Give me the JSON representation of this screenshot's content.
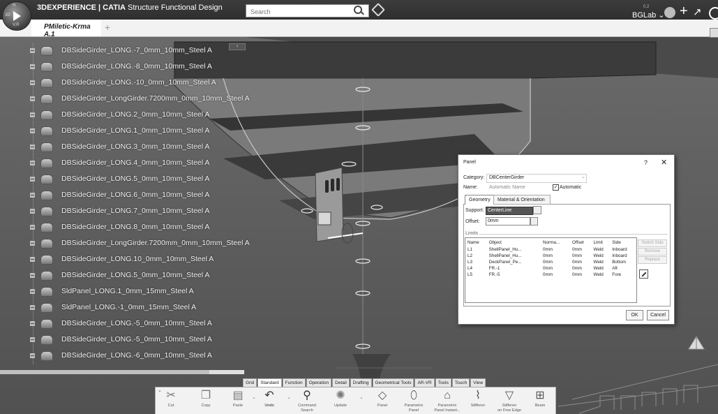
{
  "app": {
    "compass_top": "N",
    "compass_left": "3D",
    "compass_bottom": "V,R",
    "brand_prefix": "3D",
    "brand_suffix": "EXPERIENCE | ",
    "product": "CATIA",
    "workbench": " Structure Functional Design"
  },
  "search": {
    "placeholder": "Search"
  },
  "user": {
    "name": "BGLab ⌄",
    "version": "0.2"
  },
  "tabs": {
    "active": "PMiletic-Krma A.1",
    "add": "+"
  },
  "tree": {
    "items": [
      {
        "label": "DBSideGirder_LONG.-7_0mm_10mm_Steel A"
      },
      {
        "label": "DBSideGirder_LONG.-8_0mm_10mm_Steel A"
      },
      {
        "label": "DBSideGirder_LONG.-10_0mm_10mm_Steel A"
      },
      {
        "label": "DBSideGirder_LongGirder.7200mm_0mm_10mm_Steel A"
      },
      {
        "label": "DBSideGirder_LONG.2_0mm_10mm_Steel A"
      },
      {
        "label": "DBSideGirder_LONG.1_0mm_10mm_Steel A"
      },
      {
        "label": "DBSideGirder_LONG.3_0mm_10mm_Steel A"
      },
      {
        "label": "DBSideGirder_LONG.4_0mm_10mm_Steel A"
      },
      {
        "label": "DBSideGirder_LONG.5_0mm_10mm_Steel A"
      },
      {
        "label": "DBSideGirder_LONG.6_0mm_10mm_Steel A"
      },
      {
        "label": "DBSideGirder_LONG.7_0mm_10mm_Steel A"
      },
      {
        "label": "DBSideGirder_LONG.8_0mm_10mm_Steel A"
      },
      {
        "label": "DBSideGirder_LongGirder.7200mm_0mm_10mm_Steel A"
      },
      {
        "label": "DBSideGirder_LONG.10_0mm_10mm_Steel A"
      },
      {
        "label": "DBSideGirder_LONG.5_0mm_10mm_Steel A"
      },
      {
        "label": "SldPanel_LONG.1_0mm_15mm_Steel A"
      },
      {
        "label": "SldPanel_LONG.-1_0mm_15mm_Steel A"
      },
      {
        "label": "DBSideGirder_LONG.-5_0mm_10mm_Steel A"
      },
      {
        "label": "DBSideGirder_LONG.-5_0mm_10mm_Steel A"
      },
      {
        "label": "DBSideGirder_LONG.-6_0mm_10mm_Steel A"
      }
    ]
  },
  "dialog": {
    "title": "Panel",
    "help": "?",
    "close": "✕",
    "category_label": "Category:",
    "category_value": "DBCenterGirder",
    "name_label": "Name:",
    "name_value": "Automatic Name",
    "automatic_label": "Automatic",
    "automatic_checked": "✓",
    "tabs": {
      "geometry": "Geometry",
      "material": "Material & Orientation"
    },
    "support_label": "Support:",
    "support_value": "CenterLine",
    "offset_label": "Offset:",
    "offset_value": "0mm",
    "limits_label": "Limits",
    "table": {
      "headers": [
        "Name",
        "Object",
        "Norma...",
        "Offset",
        "Limit",
        "Side"
      ],
      "rows": [
        [
          "L1",
          "ShellPanel_Hu...",
          "0mm",
          "0mm",
          "Weld",
          "Inboard"
        ],
        [
          "L2",
          "ShellPanel_Hu...",
          "0mm",
          "0mm",
          "Weld",
          "Inboard"
        ],
        [
          "L3",
          "DeckPanel_Pe...",
          "0mm",
          "0mm",
          "Weld",
          "Bottom"
        ],
        [
          "L4",
          "FR.-1",
          "0mm",
          "0mm",
          "Weld",
          "Aft"
        ],
        [
          "L5",
          "FR.-5",
          "0mm",
          "0mm",
          "Weld",
          "Fore"
        ]
      ]
    },
    "side_buttons": {
      "switch": "Switch Side",
      "remove": "Remove",
      "replace": "Replace"
    },
    "ok": "OK",
    "cancel": "Cancel"
  },
  "action_bar": {
    "tabs": [
      "Grid",
      "Standard",
      "Function",
      "Operation",
      "Detail",
      "Drafting",
      "Geometrical Tools",
      "AR-VR",
      "Tools",
      "Touch",
      "View"
    ],
    "active_tab": "Standard",
    "buttons": {
      "cut": "Cut",
      "copy": "Copy",
      "paste": "Paste",
      "undo": "Undo",
      "command_search_1": "Command",
      "command_search_2": "Search",
      "update": "Update",
      "panel": "Panel",
      "parametric_panel_1": "Parametric",
      "parametric_panel_2": "Panel",
      "parametric_panel_instant_1": "Parametric",
      "parametric_panel_instant_2": "Panel Instant...",
      "stiffener": "Stiffener",
      "stiffener_free_edge_1": "Stiffener",
      "stiffener_free_edge_2": "on Free Edge",
      "beam": "Beam"
    }
  },
  "colors": {
    "topbar": "#2f2f2f",
    "viewport": "#5e5e5e",
    "dialog_bg": "#ffffff",
    "support_highlight": "#555555"
  }
}
